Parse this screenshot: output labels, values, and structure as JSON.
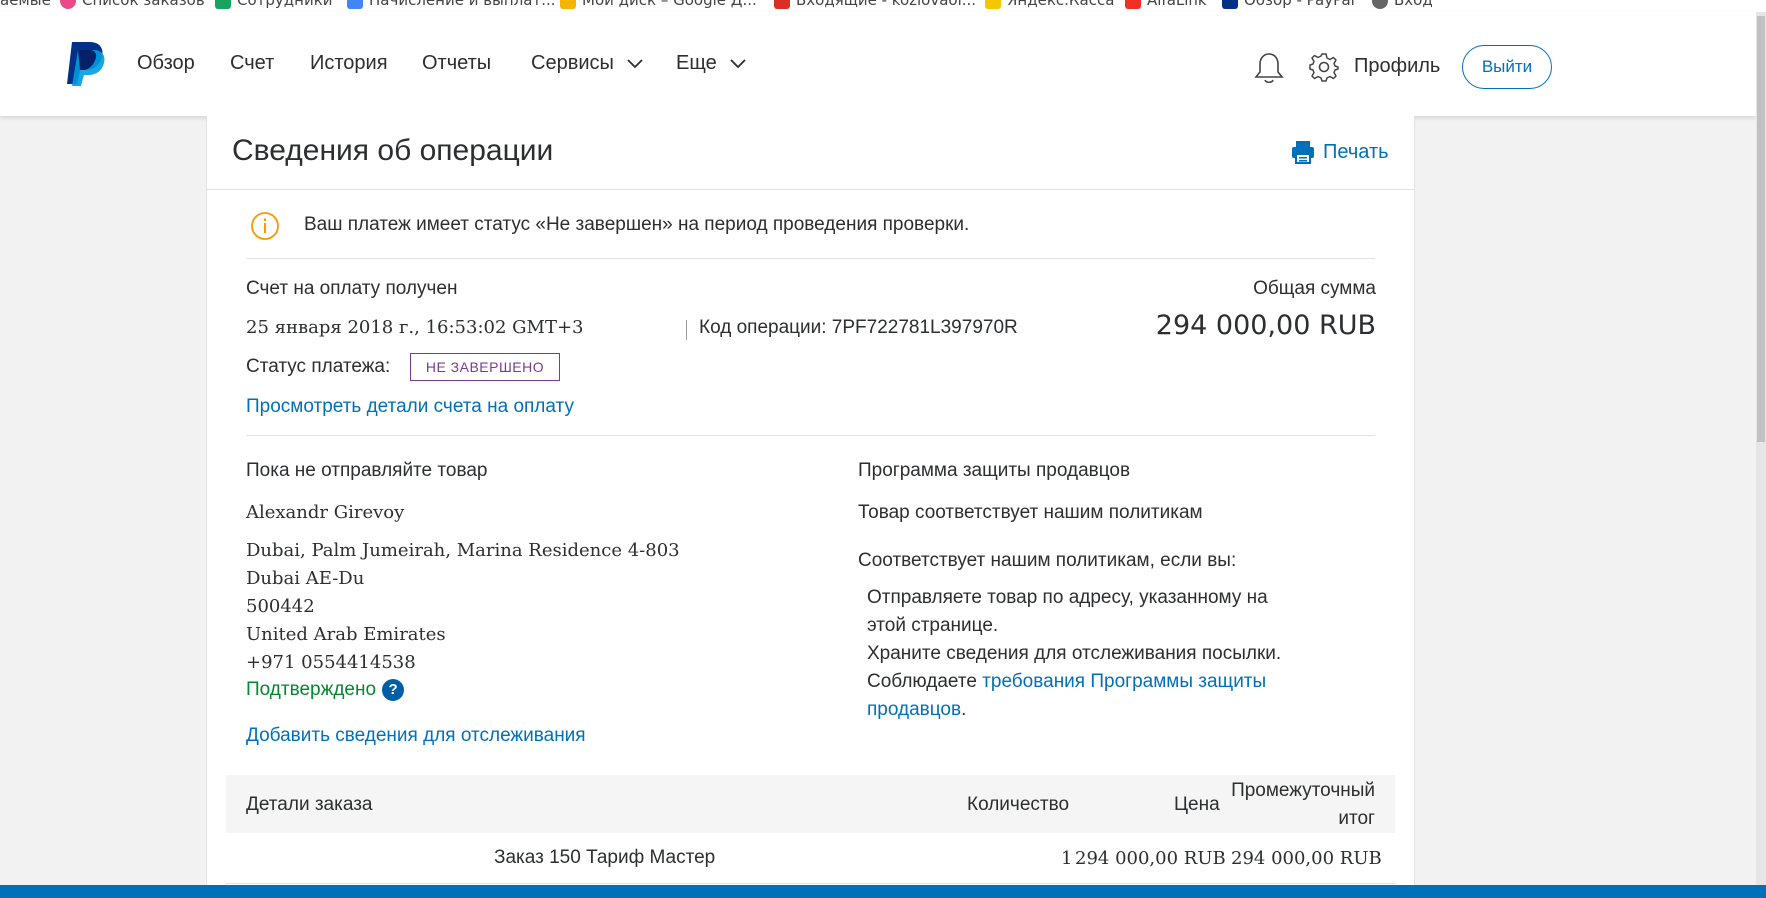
{
  "bookmarks": [
    {
      "label": "аемые",
      "color": "#ffffff"
    },
    {
      "label": "Список заказов",
      "color": "#e94b86"
    },
    {
      "label": "Сотрудники",
      "color": "#1aa260"
    },
    {
      "label": "Начисление и выплат...",
      "color": "#4285f4"
    },
    {
      "label": "Мой диск – Google Д...",
      "color": "#f4b400"
    },
    {
      "label": "Входящие - kozlovaol...",
      "color": "#d93025"
    },
    {
      "label": "Яндекс.Касса",
      "color": "#f6c700"
    },
    {
      "label": "AlfaLink",
      "color": "#ef3124"
    },
    {
      "label": "Обзор - PayPal",
      "color": "#003087"
    },
    {
      "label": "Вход",
      "color": "#666666"
    }
  ],
  "header": {
    "nav": {
      "overview": "Обзор",
      "account": "Счет",
      "history": "История",
      "reports": "Отчеты",
      "services": "Сервисы",
      "more": "Еще"
    },
    "profile": "Профиль",
    "logout": "Выйти"
  },
  "card": {
    "title": "Сведения об операции",
    "print": "Печать",
    "alert": "Ваш платеж имеет статус «Не завершен» на период проведения проверки.",
    "invoice_received": "Счет на оплату получен",
    "date": "25 января 2018 г., 16:53:02 GMT+3",
    "operation_code": "Код операции: 7PF722781L397970R",
    "total_label": "Общая сумма",
    "total_amount": "294 000,00 RUB",
    "payment_status_label": "Статус платежа:",
    "payment_status": "НЕ ЗАВЕРШЕНО",
    "view_invoice_link": "Просмотреть детали счета на оплату",
    "shipping": {
      "heading": "Пока не отправляйте товар",
      "name": "Alexandr Girevoy",
      "address_lines": [
        "Dubai, Palm Jumeirah, Marina Residence 4-803",
        "Dubai AE-Du",
        "500442",
        "United Arab Emirates",
        "+971 0554414538"
      ],
      "confirmed": "Подтверждено",
      "help": "?",
      "add_tracking": "Добавить сведения для отслеживания"
    },
    "protection": {
      "heading": "Программа защиты продавцов",
      "meets": "Товар соответствует нашим политикам",
      "if_you": "Соответствует нашим политикам, если вы:",
      "item1": "Отправляете товар по адресу, указанному на этой странице.",
      "item2": "Храните сведения для отслеживания посылки.",
      "item3_prefix": "Соблюдаете ",
      "item3_link": "требования Программы защиты продавцов",
      "item3_suffix": "."
    },
    "order": {
      "col_details": "Детали заказа",
      "col_qty": "Количество",
      "col_price": "Цена",
      "col_subtotal": "Промежуточный итог",
      "row": {
        "name": "Заказ 150 Тариф Мастер",
        "qty": "1",
        "price": "294 000,00 RUB",
        "subtotal": "294 000,00 RUB"
      }
    }
  }
}
